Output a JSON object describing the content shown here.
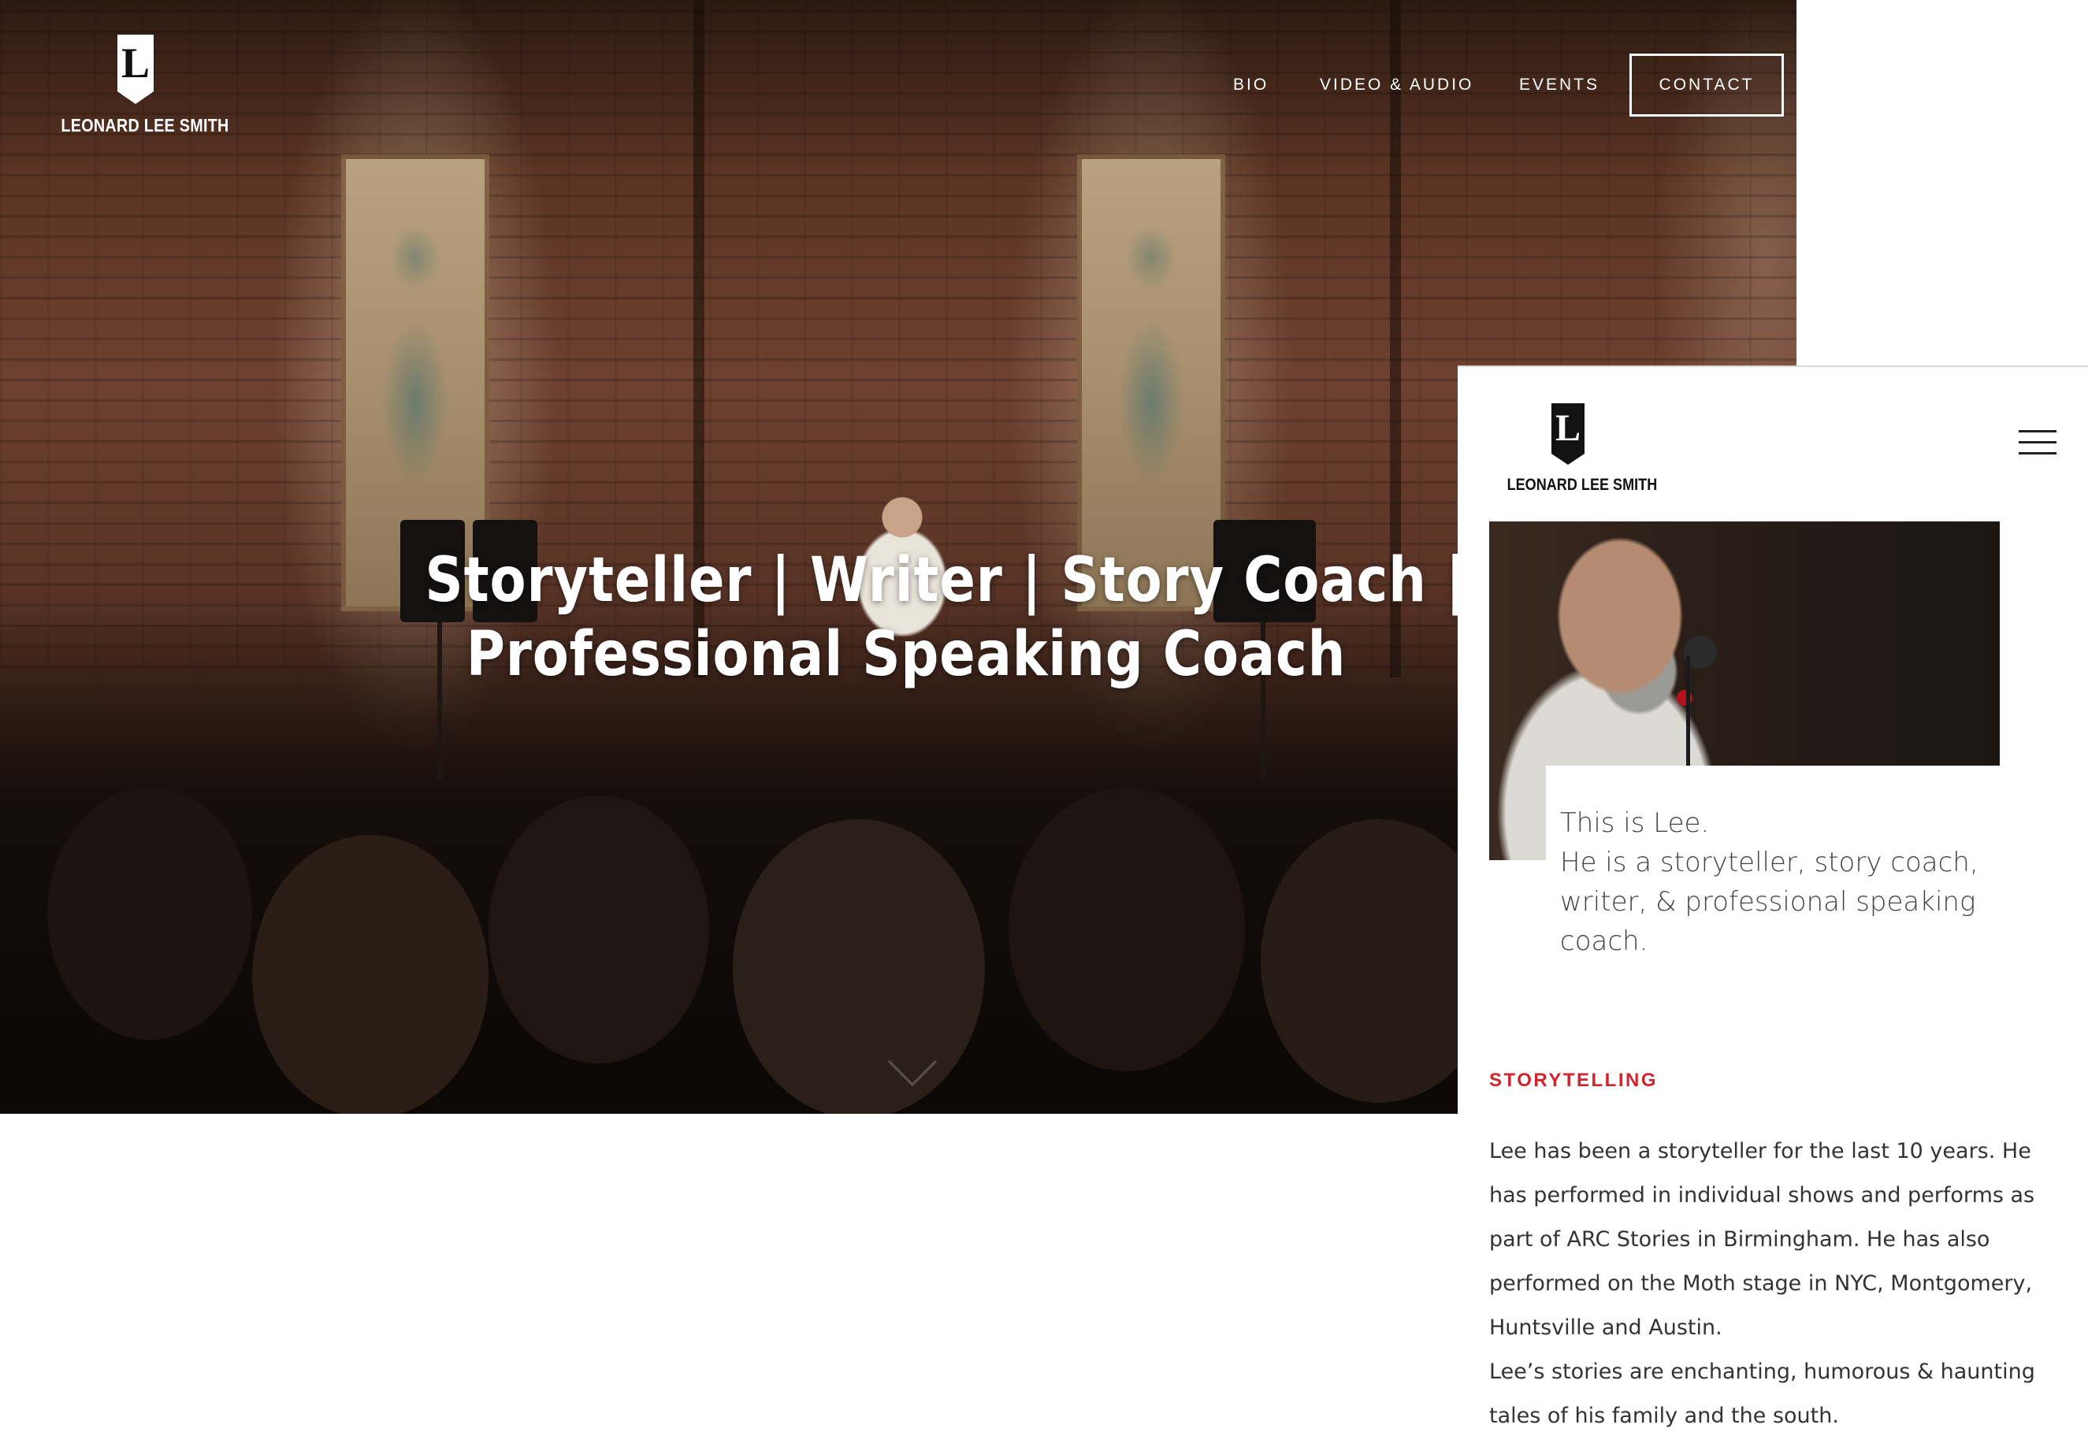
{
  "desktop": {
    "logo": {
      "letter": "L",
      "name": "LEONARD LEE SMITH"
    },
    "nav": {
      "bio": "BIO",
      "video_audio": "VIDEO & AUDIO",
      "events": "EVENTS",
      "contact": "CONTACT"
    },
    "hero": {
      "headline_line1": "Storyteller | Writer | Story Coach |",
      "headline_line2": "Professional Speaking Coach"
    },
    "icons": {
      "scroll": "chevron-down-icon"
    }
  },
  "mobile": {
    "logo": {
      "letter": "L",
      "name": "LEONARD LEE SMITH"
    },
    "icons": {
      "menu": "hamburger-menu-icon"
    },
    "intro": {
      "line1": "This is Lee.",
      "line2": "He is a storyteller, story coach, writer, & professional speaking coach."
    },
    "section_title": "STORYTELLING",
    "paragraph1": "Lee has been a storyteller for the last 10 years.  He has performed in individual shows and performs as part of ARC Stories in Birmingham. He has also performed on the Moth stage in NYC, Montgomery, Huntsville and Austin.",
    "paragraph2": "Lee’s stories are enchanting, humorous & haunting tales of his family and the south."
  },
  "colors": {
    "accent_red": "#d0242c",
    "text_dark": "#333333",
    "nav_text": "#ffffff"
  }
}
